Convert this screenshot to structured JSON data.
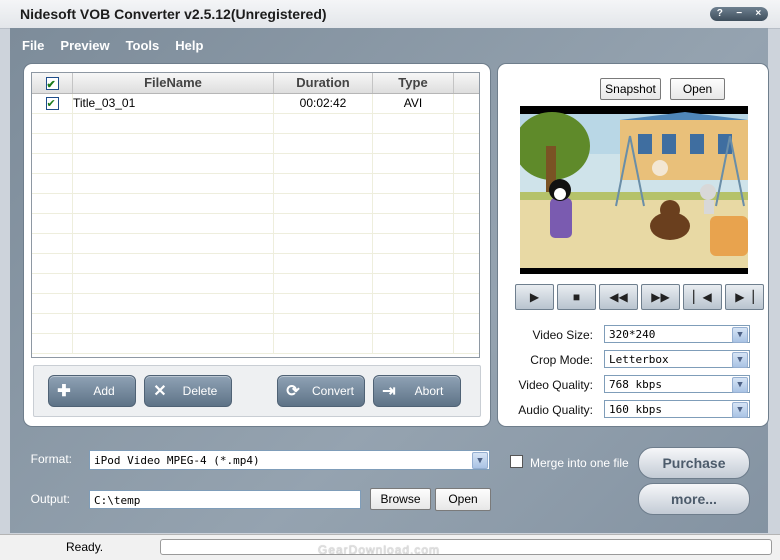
{
  "window": {
    "title": "Nidesoft VOB Converter v2.5.12(Unregistered)",
    "controls": [
      "?",
      "−",
      "×"
    ]
  },
  "menu": [
    "File",
    "Preview",
    "Tools",
    "Help"
  ],
  "file_list": {
    "columns": [
      "FileName",
      "Duration",
      "Type"
    ],
    "rows": [
      {
        "checked": true,
        "name": "Title_03_01",
        "duration": "00:02:42",
        "type": "AVI"
      }
    ]
  },
  "actions": {
    "add": "Add",
    "delete": "Delete",
    "convert": "Convert",
    "abort": "Abort"
  },
  "preview": {
    "snapshot": "Snapshot",
    "open": "Open"
  },
  "settings": {
    "video_size_label": "Video Size:",
    "video_size": "320*240",
    "crop_mode_label": "Crop Mode:",
    "crop_mode": "Letterbox",
    "video_quality_label": "Video Quality:",
    "video_quality": "768 kbps",
    "audio_quality_label": "Audio Quality:",
    "audio_quality": "160 kbps"
  },
  "output": {
    "format_label": "Format:",
    "format_value": "iPod Video MPEG-4 (*.mp4)",
    "output_label": "Output:",
    "output_value": "C:\\temp",
    "browse": "Browse",
    "open": "Open",
    "merge_label": "Merge into one file",
    "merge_checked": false
  },
  "buttons": {
    "purchase": "Purchase",
    "more": "more..."
  },
  "status": {
    "text": "Ready.",
    "progress": 0,
    "watermark": "GearDownload.com"
  },
  "colors": {
    "accent": "#5e7387",
    "background": "#8e9cab"
  }
}
